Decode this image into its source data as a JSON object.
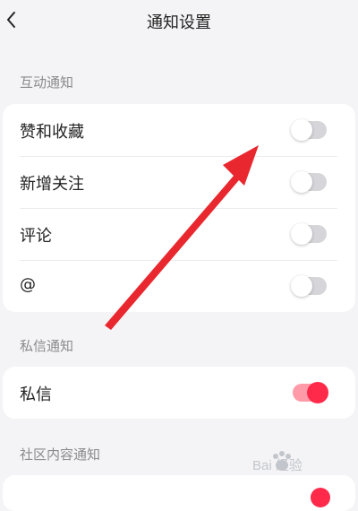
{
  "header": {
    "title": "通知设置",
    "back_icon": "chevron-left-icon"
  },
  "sections": [
    {
      "title": "互动通知",
      "items": [
        {
          "label": "赞和收藏",
          "enabled": false
        },
        {
          "label": "新增关注",
          "enabled": false
        },
        {
          "label": "评论",
          "enabled": false
        },
        {
          "label": "@",
          "enabled": false
        }
      ]
    },
    {
      "title": "私信通知",
      "items": [
        {
          "label": "私信",
          "enabled": true
        }
      ]
    },
    {
      "title": "社区内容通知",
      "items": []
    }
  ],
  "colors": {
    "accent": "#ff2a4a",
    "annotation_arrow": "#e8282e"
  },
  "watermark": {
    "text": "Bai 经验"
  }
}
